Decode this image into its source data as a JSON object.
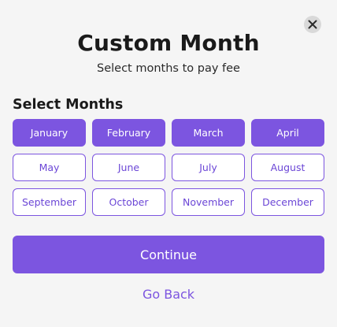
{
  "modal": {
    "title": "Custom Month",
    "subtitle": "Select months to pay fee",
    "section_label": "Select Months",
    "close_icon": "close-icon"
  },
  "months": [
    {
      "label": "January",
      "selected": true
    },
    {
      "label": "February",
      "selected": true
    },
    {
      "label": "March",
      "selected": true
    },
    {
      "label": "April",
      "selected": true
    },
    {
      "label": "May",
      "selected": false
    },
    {
      "label": "June",
      "selected": false
    },
    {
      "label": "July",
      "selected": false
    },
    {
      "label": "August",
      "selected": false
    },
    {
      "label": "September",
      "selected": false
    },
    {
      "label": "October",
      "selected": false
    },
    {
      "label": "November",
      "selected": false
    },
    {
      "label": "December",
      "selected": false
    }
  ],
  "actions": {
    "continue_label": "Continue",
    "go_back_label": "Go Back"
  },
  "colors": {
    "accent": "#7c55e0",
    "background": "#f5f5f5",
    "close_bg": "#d9d9d9"
  }
}
